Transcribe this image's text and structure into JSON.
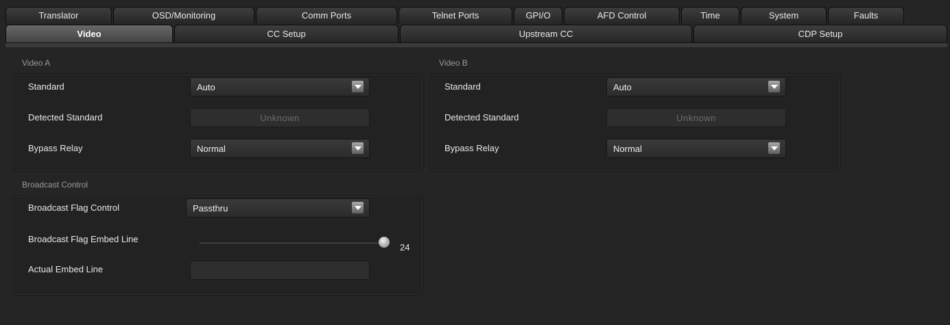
{
  "tabs_top": [
    {
      "label": "Translator",
      "width": 155
    },
    {
      "label": "OSD/Monitoring",
      "width": 206
    },
    {
      "label": "Comm Ports",
      "width": 206
    },
    {
      "label": "Telnet Ports",
      "width": 166
    },
    {
      "label": "GPI/O",
      "width": 71
    },
    {
      "label": "AFD Control",
      "width": 169
    },
    {
      "label": "Time",
      "width": 85
    },
    {
      "label": "System",
      "width": 125
    },
    {
      "label": "Faults",
      "width": 111
    }
  ],
  "tabs_bottom": [
    {
      "label": "Video",
      "width": 244,
      "active": true
    },
    {
      "label": "CC Setup",
      "width": 327
    },
    {
      "label": "Upstream CC",
      "width": 426
    },
    {
      "label": "CDP Setup",
      "width": 370
    }
  ],
  "video_a": {
    "title": "Video A",
    "standard_label": "Standard",
    "standard_value": "Auto",
    "detected_label": "Detected Standard",
    "detected_value": "Unknown",
    "bypass_label": "Bypass Relay",
    "bypass_value": "Normal"
  },
  "video_b": {
    "title": "Video B",
    "standard_label": "Standard",
    "standard_value": "Auto",
    "detected_label": "Detected Standard",
    "detected_value": "Unknown",
    "bypass_label": "Bypass Relay",
    "bypass_value": "Normal"
  },
  "broadcast": {
    "title": "Broadcast Control",
    "flag_control_label": "Broadcast Flag Control",
    "flag_control_value": "Passthru",
    "embed_line_label": "Broadcast Flag Embed Line",
    "embed_line_value": "24",
    "embed_line_fraction": 1.0,
    "actual_label": "Actual Embed Line",
    "actual_value": ""
  },
  "icons": {
    "dropdown": "chevron-down-icon"
  }
}
